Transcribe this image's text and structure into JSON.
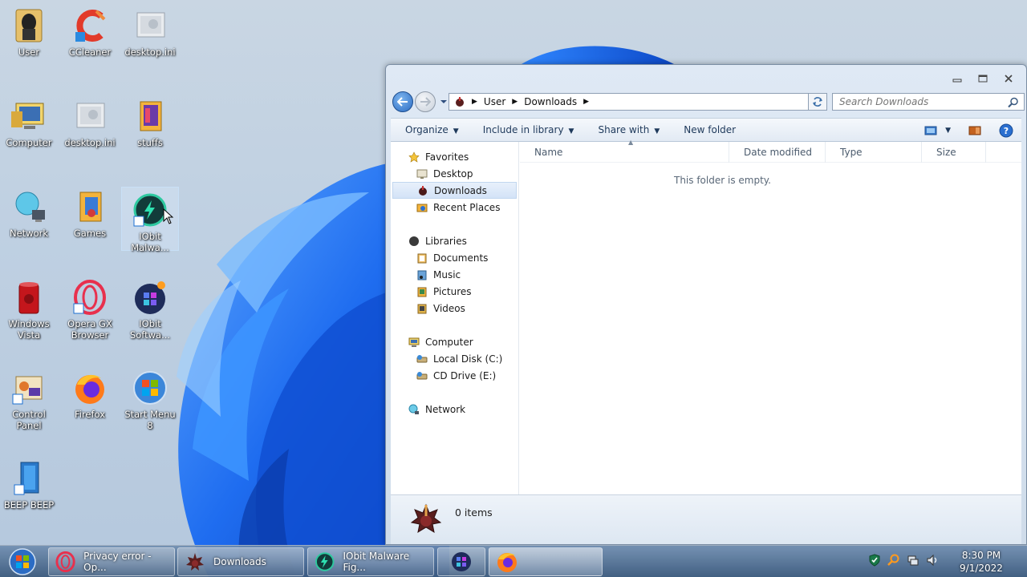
{
  "desktop": {
    "icons": [
      {
        "label": "User"
      },
      {
        "label": "CCleaner"
      },
      {
        "label": "desktop.ini"
      },
      {
        "label": "Computer"
      },
      {
        "label": "desktop.ini"
      },
      {
        "label": "stuffs"
      },
      {
        "label": "Network"
      },
      {
        "label": "Games"
      },
      {
        "label": "IObit Malwa..."
      },
      {
        "label": "Windows Vista"
      },
      {
        "label": "Opera GX Browser"
      },
      {
        "label": "IObit Softwa..."
      },
      {
        "label": "Control Panel"
      },
      {
        "label": "Firefox"
      },
      {
        "label": "Start Menu 8"
      },
      {
        "label": "BEEP BEEP"
      }
    ]
  },
  "explorer": {
    "breadcrumb": [
      "User",
      "Downloads"
    ],
    "search_placeholder": "Search Downloads",
    "commands": {
      "organize": "Organize",
      "include": "Include in library",
      "share": "Share with",
      "new_folder": "New folder"
    },
    "nav": {
      "favorites": "Favorites",
      "desktop": "Desktop",
      "downloads": "Downloads",
      "recent": "Recent Places",
      "libraries": "Libraries",
      "documents": "Documents",
      "music": "Music",
      "pictures": "Pictures",
      "videos": "Videos",
      "computer": "Computer",
      "local_disk": "Local Disk (C:)",
      "cd_drive": "CD Drive (E:)",
      "network": "Network"
    },
    "columns": {
      "name": "Name",
      "date": "Date modified",
      "type": "Type",
      "size": "Size"
    },
    "empty_message": "This folder is empty.",
    "item_count": "0 items"
  },
  "taskbar": {
    "tasks": {
      "opera": "Privacy error - Op...",
      "downloads": "Downloads",
      "iobit": "IObit Malware Fig..."
    },
    "clock_time": "8:30 PM",
    "clock_date": "9/1/2022"
  },
  "colors": {
    "accent": "#1f63c9",
    "selection": "#d3e3f7",
    "taskbar": "#4a6d95"
  }
}
